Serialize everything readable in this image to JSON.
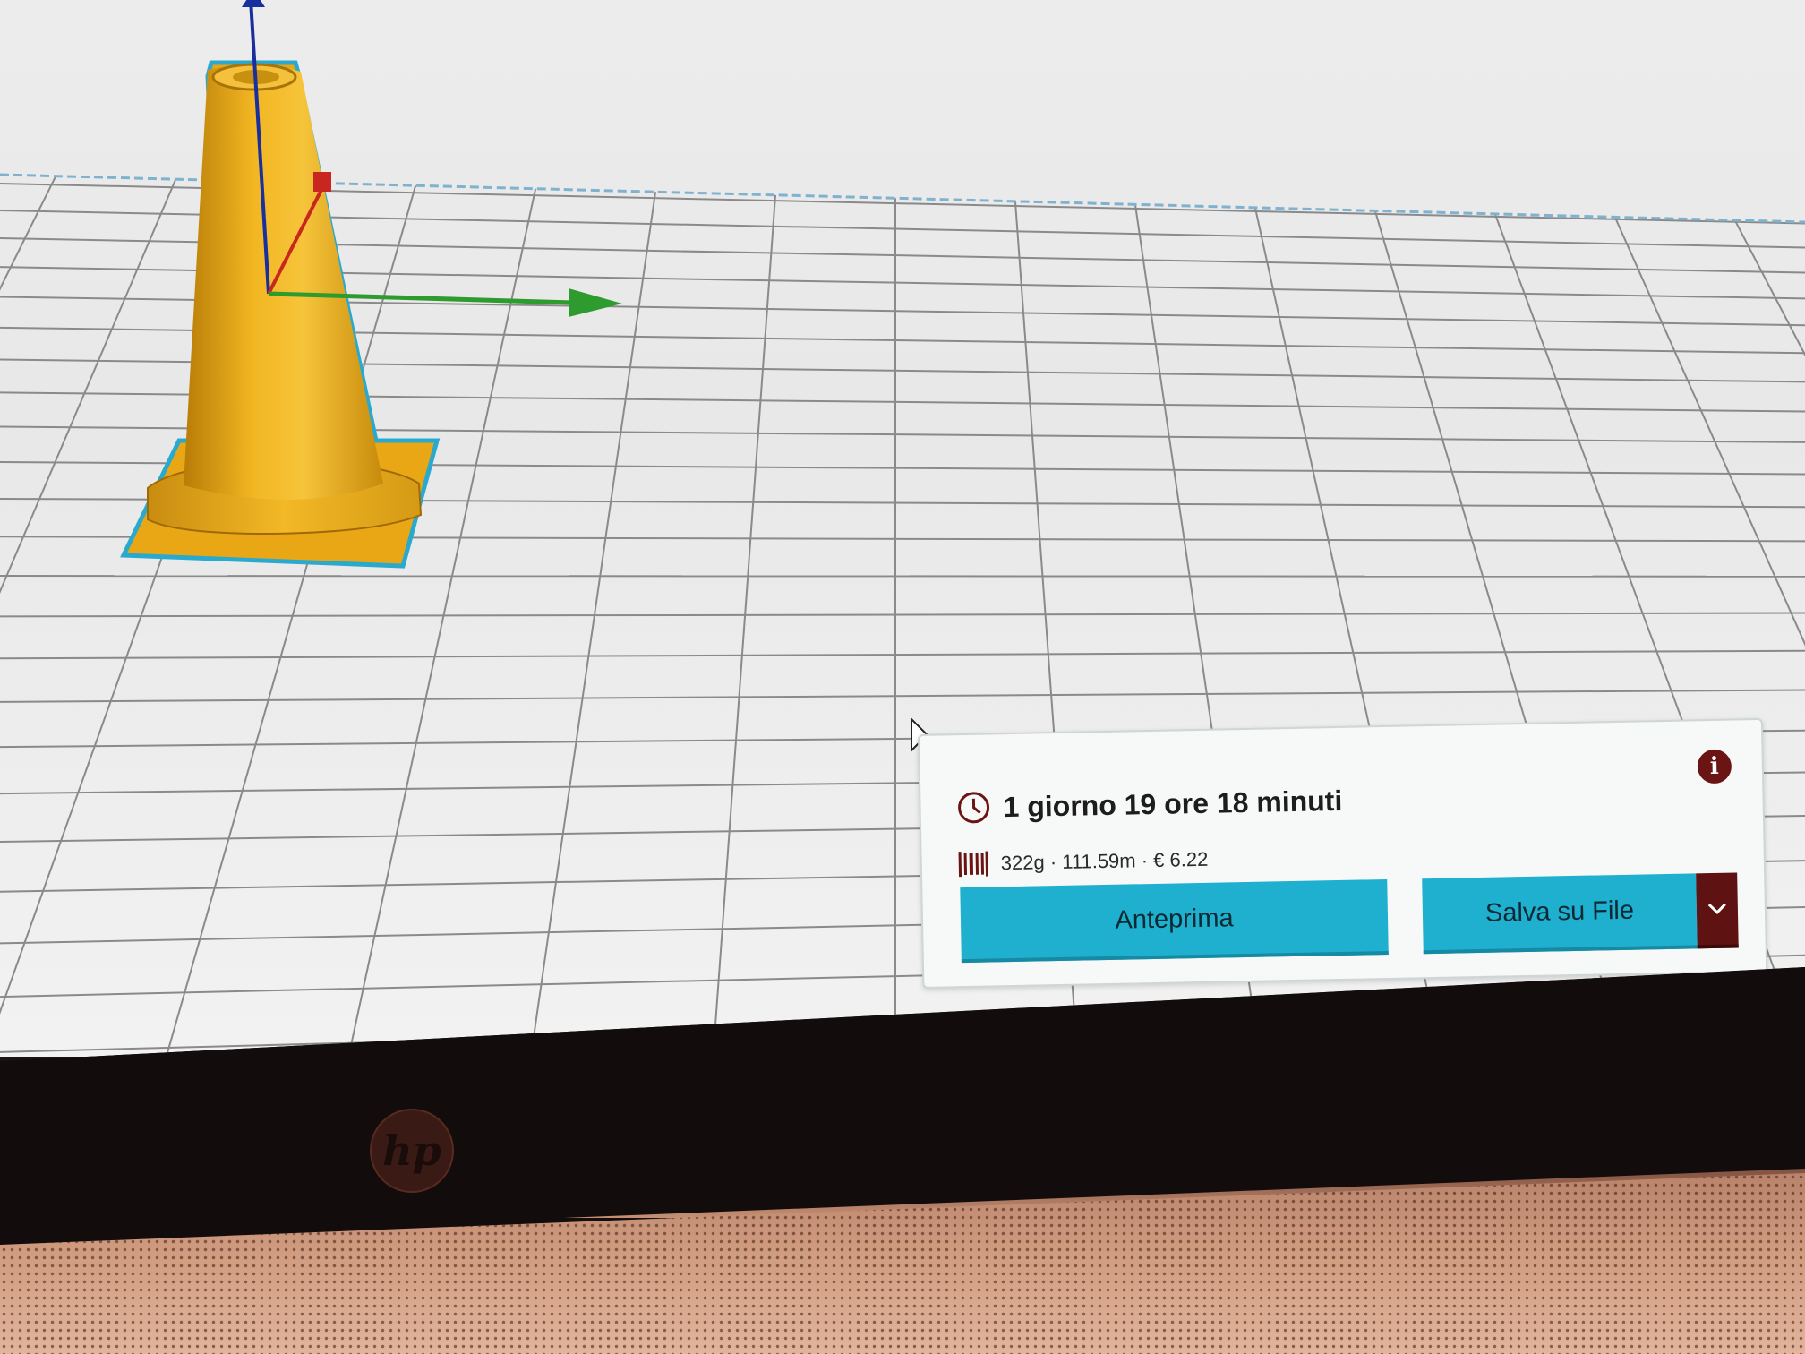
{
  "print_info": {
    "print_time": "1 giorno 19 ore 18 minuti",
    "material_summary": "322g · 111.59m · € 6.22",
    "buttons": {
      "preview_label": "Anteprima",
      "save_label": "Salva su File"
    },
    "icons": {
      "time": "clock-icon",
      "material": "filament-spool-icon",
      "info": "info-icon",
      "dropdown": "chevron-down-icon"
    }
  },
  "colors": {
    "model": "#f2b01e",
    "selection_outline": "#2aa9cf",
    "button_primary": "#1fb0cf",
    "dropdown_button": "#5e1212",
    "axis_x": "#2e9b2e",
    "axis_y": "#c8261e",
    "axis_z": "#1a2f9e"
  },
  "laptop": {
    "brand_logo": "hp"
  }
}
